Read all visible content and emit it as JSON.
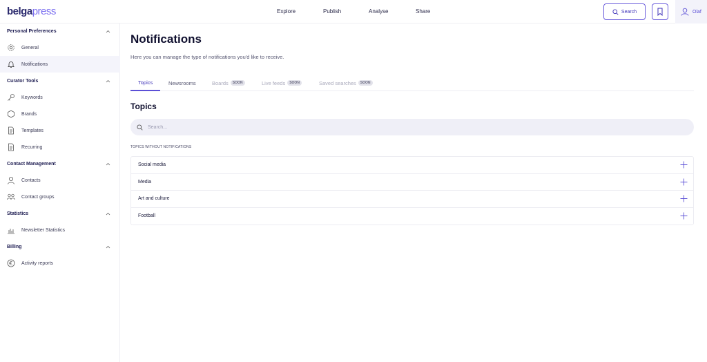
{
  "header": {
    "logo_part1": "belga",
    "logo_part2": "press",
    "nav": [
      "Explore",
      "Publish",
      "Analyse",
      "Share"
    ],
    "search_label": "Search",
    "user_name": "Olaf"
  },
  "sidebar": {
    "sections": [
      {
        "title": "Personal Preferences",
        "items": [
          {
            "label": "General",
            "icon": "gear-icon"
          },
          {
            "label": "Notifications",
            "icon": "bell-icon"
          }
        ]
      },
      {
        "title": "Curator Tools",
        "items": [
          {
            "label": "Keywords",
            "icon": "key-icon"
          },
          {
            "label": "Brands",
            "icon": "hexagon-icon"
          },
          {
            "label": "Templates",
            "icon": "document-icon"
          },
          {
            "label": "Recurring",
            "icon": "document-icon"
          }
        ]
      },
      {
        "title": "Contact Management",
        "items": [
          {
            "label": "Contacts",
            "icon": "user-icon"
          },
          {
            "label": "Contact groups",
            "icon": "users-icon"
          }
        ]
      },
      {
        "title": "Statistics",
        "items": [
          {
            "label": "Newsletter Statistics",
            "icon": "bar-chart-icon"
          }
        ]
      },
      {
        "title": "Billing",
        "items": [
          {
            "label": "Activity reports",
            "icon": "euro-icon"
          }
        ]
      }
    ],
    "active_item": "Notifications"
  },
  "main": {
    "title": "Notifications",
    "subtitle": "Here you can manage the type of notifications you'd like to receive.",
    "tabs": [
      {
        "label": "Topics",
        "badge": ""
      },
      {
        "label": "Newsrooms",
        "badge": ""
      },
      {
        "label": "Boards",
        "badge": "SOON"
      },
      {
        "label": "Live feeds",
        "badge": "SOON"
      },
      {
        "label": "Saved searches",
        "badge": "SOON"
      }
    ],
    "section_title": "Topics",
    "search_placeholder": "Search...",
    "list_caption": "TOPICS WITHOUT NOTIFICATIONS",
    "topics": [
      "Social media",
      "Media",
      "Art and culture",
      "Football"
    ]
  },
  "colors": {
    "accent": "#5b4fd6",
    "brand_dark": "#2b2a6e"
  }
}
